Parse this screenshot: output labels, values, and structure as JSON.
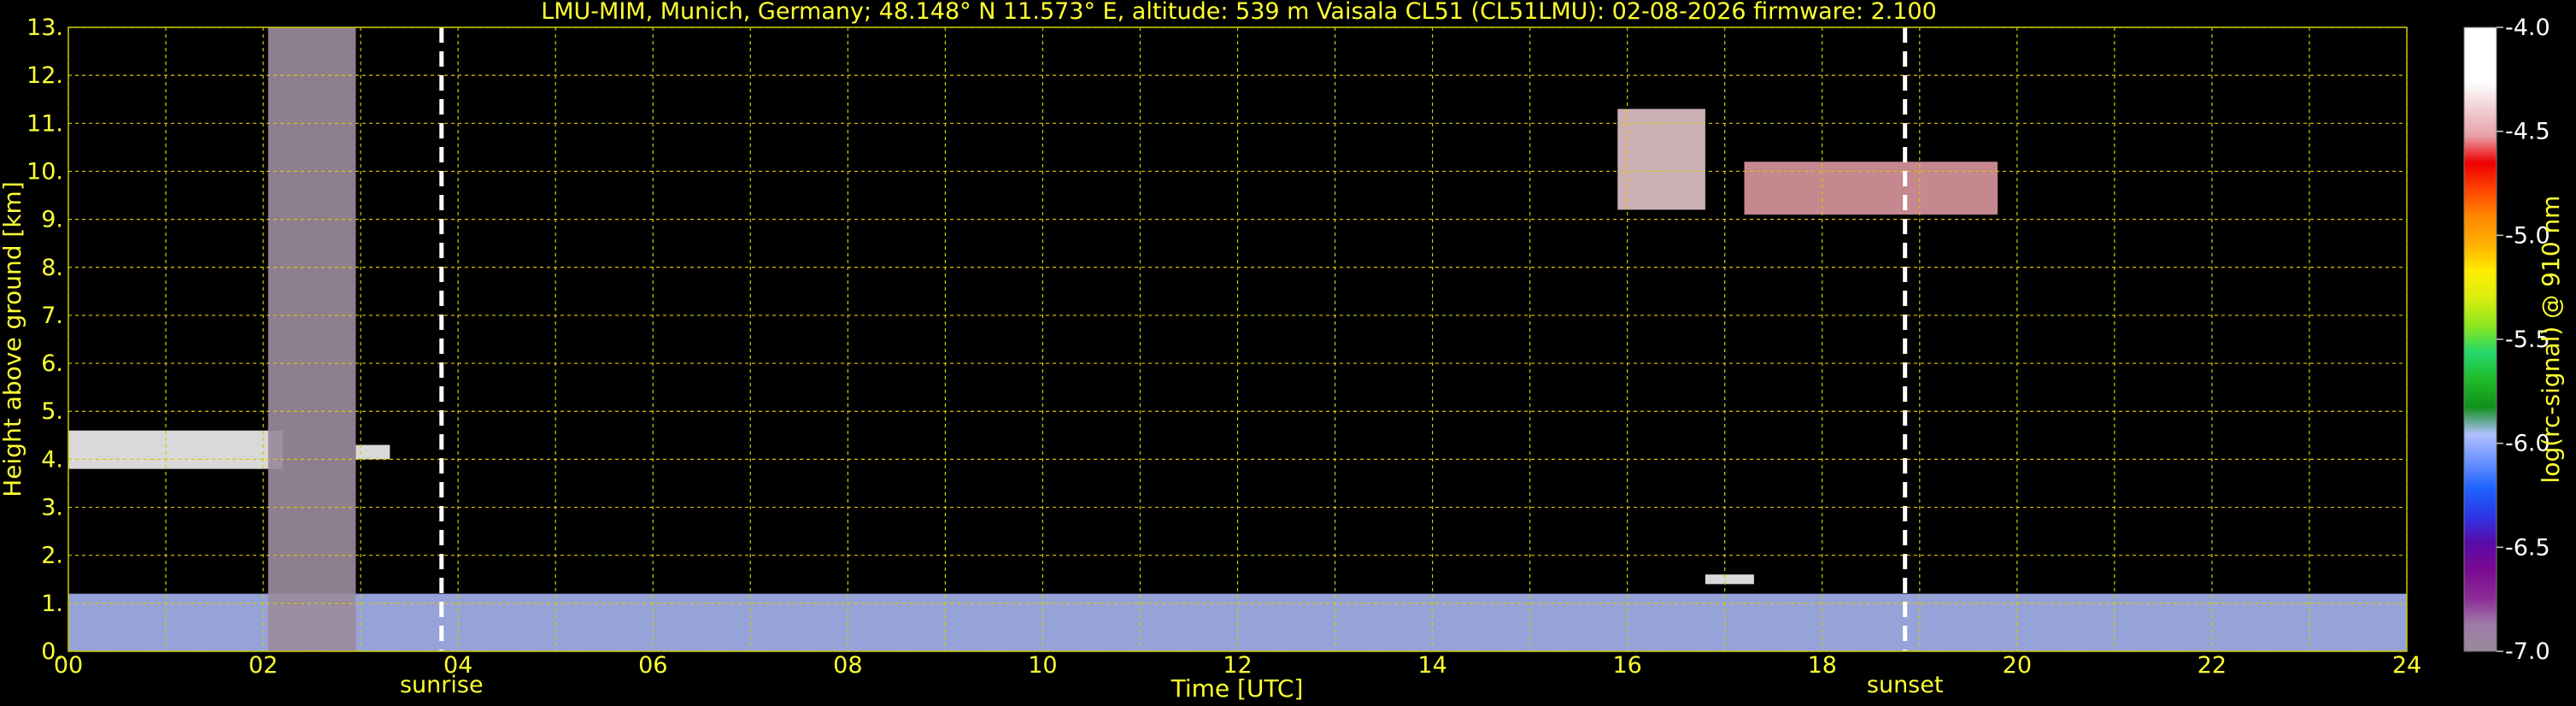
{
  "chart_data": {
    "type": "heatmap",
    "title": "LMU-MIM, Munich, Germany; 48.148° N 11.573° E, altitude: 539 m    Vaisala CL51 (CL51LMU): 02-08-2026    firmware: 2.100",
    "xlabel": "Time [UTC]",
    "ylabel": "Height above ground [km]",
    "xlim": [
      0,
      24
    ],
    "ylim": [
      0,
      13
    ],
    "x_ticks": [
      "00",
      "02",
      "04",
      "06",
      "08",
      "10",
      "12",
      "14",
      "16",
      "18",
      "20",
      "22",
      "24"
    ],
    "y_ticks": [
      "0.",
      "1.",
      "2.",
      "3.",
      "4.",
      "5.",
      "6.",
      "7.",
      "8.",
      "9.",
      "10.",
      "11.",
      "12.",
      "13."
    ],
    "grid": true,
    "grid_color": "#d8c800",
    "label_color": "#ffff33",
    "background": "#000000",
    "annotations": [
      {
        "label": "sunrise",
        "time": 3.83
      },
      {
        "label": "sunset",
        "time": 18.85
      }
    ],
    "colorbar": {
      "label": "log(rc-signal) @ 910 nm",
      "range": [
        -7.0,
        -4.0
      ],
      "ticks": [
        "-4.0",
        "-4.5",
        "-5.0",
        "-5.5",
        "-6.0",
        "-6.5",
        "-7.0"
      ],
      "colors": [
        "#9a8a9c",
        "#a07aa8",
        "#8a2a95",
        "#7a0a92",
        "#5a0aa8",
        "#2a38e8",
        "#1e62ff",
        "#6a92ff",
        "#b0c0ff",
        "#10901a",
        "#1fbb2a",
        "#23d86a",
        "#8ce820",
        "#d8ee10",
        "#ffee00",
        "#ffb000",
        "#ff8800",
        "#ff4400",
        "#ee0000",
        "#e8a0a8",
        "#f0d0d4",
        "#ffffff",
        "#ffffff",
        "#ffffff"
      ]
    },
    "features": [
      {
        "name": "cloud",
        "t0": 0.0,
        "t1": 2.2,
        "h0": 3.8,
        "h1": 4.6,
        "level": -4.3
      },
      {
        "name": "cloud",
        "t0": 2.95,
        "t1": 3.3,
        "h0": 4.0,
        "h1": 4.3,
        "level": -4.3
      },
      {
        "name": "cloud",
        "t0": 15.9,
        "t1": 16.8,
        "h0": 9.2,
        "h1": 11.3,
        "level": -4.4
      },
      {
        "name": "cloud",
        "t0": 17.2,
        "t1": 19.8,
        "h0": 9.1,
        "h1": 10.2,
        "level": -4.5
      },
      {
        "name": "cloud",
        "t0": 16.8,
        "t1": 17.3,
        "h0": 1.4,
        "h1": 1.6,
        "level": -4.3
      },
      {
        "name": "boundary-layer",
        "t0": 0.0,
        "t1": 24.0,
        "h0": 0.0,
        "h1": 1.2,
        "level": -5.9
      },
      {
        "name": "data-gap",
        "t0": 2.05,
        "t1": 2.95,
        "h0": 0.0,
        "h1": 13.0,
        "level": -7.0
      }
    ]
  }
}
